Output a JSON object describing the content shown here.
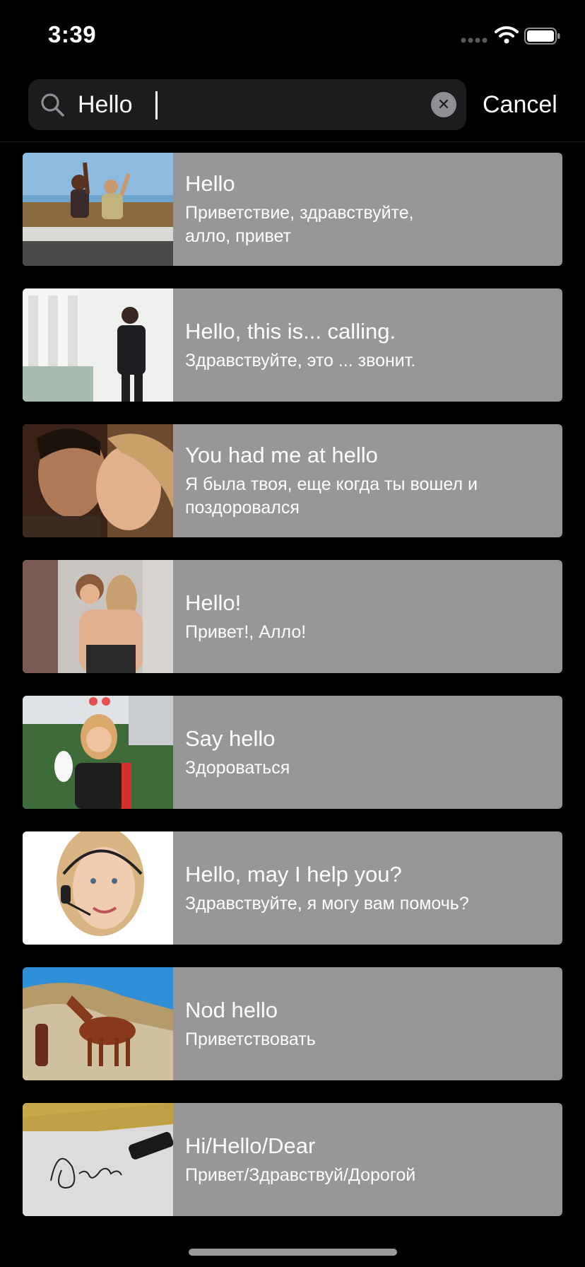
{
  "status_bar": {
    "time": "3:39",
    "icons": [
      "signal-dots-icon",
      "wifi-icon",
      "battery-icon"
    ]
  },
  "search": {
    "value": "Hello",
    "cancel_label": "Cancel",
    "icon": "search-icon",
    "clear_icon": "clear-icon"
  },
  "colors": {
    "background": "#000000",
    "search_field": "#1c1c1e",
    "card": "#979797",
    "text": "#ffffff"
  },
  "results": [
    {
      "title": "Hello",
      "subtitle": "Приветствие, здравствуйте,\nалло, привет",
      "image": "two-people-waving-in-car-photo"
    },
    {
      "title": "Hello, this is... calling.",
      "subtitle": "Здравствуйте, это ... звонит.",
      "image": "businesswoman-on-phone-photo"
    },
    {
      "title": "You had me at hello",
      "subtitle": "Я была твоя, еще когда ты вошел и поздоровался",
      "image": "couple-close-faces-photo"
    },
    {
      "title": "Hello!",
      "subtitle": "Привет!, Алло!",
      "image": "two-women-hugging-photo"
    },
    {
      "title": "Say hello",
      "subtitle": "Здороваться",
      "image": "woman-waving-white-gloves-photo"
    },
    {
      "title": "Hello, may I help you?",
      "subtitle": "Здравствуйте, я могу вам помочь?",
      "image": "woman-with-headset-photo"
    },
    {
      "title": "Nod hello",
      "subtitle": "Приветствовать",
      "image": "horse-in-desert-photo"
    },
    {
      "title": "Hi/Hello/Dear",
      "subtitle": "Привет/Здравствуй/Дорогой",
      "image": "handwritten-dear-letter-photo"
    }
  ]
}
